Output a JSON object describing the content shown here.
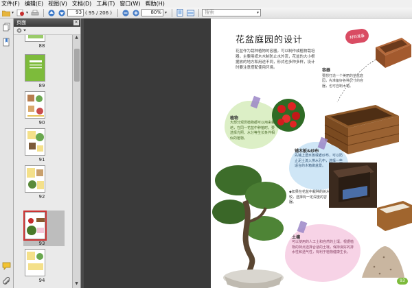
{
  "menu": {
    "items": [
      "文件(F)",
      "编辑(E)",
      "视图(V)",
      "文档(D)",
      "工具(T)",
      "窗口(W)",
      "帮助(H)"
    ]
  },
  "toolbar": {
    "page_number": "93",
    "page_total": "( 95 / 206 )",
    "zoom": "80%",
    "search_placeholder": "搜索"
  },
  "pages_panel": {
    "title": "页面",
    "thumbnails": [
      {
        "label": "88"
      },
      {
        "label": "89"
      },
      {
        "label": "90"
      },
      {
        "label": "91"
      },
      {
        "label": "92"
      },
      {
        "label": "93"
      },
      {
        "label": "94"
      }
    ],
    "selected_page": "93"
  },
  "document": {
    "title": "花盆庭园的设计",
    "tag": "材料准备",
    "intro": "花盆作为栽种植物的容器，可以制作成植物栽培器，主要用纸木木制防止水外流，花盆的大小根据放的地方和用途不同，形式也多种多样，设计时要注意搭配使用环境。",
    "box1_heading": "容器",
    "box1_text": "要想打造一个美丽的花盆庭园，先准备好各种尺寸的容器，也可自制木箱。",
    "plants_heading": "植物",
    "plants_text": "大部分观赏植物都可以用来栽培，在同一花盆中种植时，要选择光照、水分等生长条件相似的植物。",
    "wood_heading": "铺木板&纱布",
    "wood_text": "先铺上透水板或者纱布，可以防止泥土流入排水孔中，选择一些适合的木箱做盆景。",
    "mid_text": "◆如果在花盆中栽种的树木较，选择有一定深度的容器。",
    "soil_heading": "土壤",
    "soil_text": "可以使用的人工土和自然的土壤，根据植物的特点选择合适的土壤，保持良好的排水性和透气性，有利于植物健康生长。",
    "page_number": "93"
  }
}
